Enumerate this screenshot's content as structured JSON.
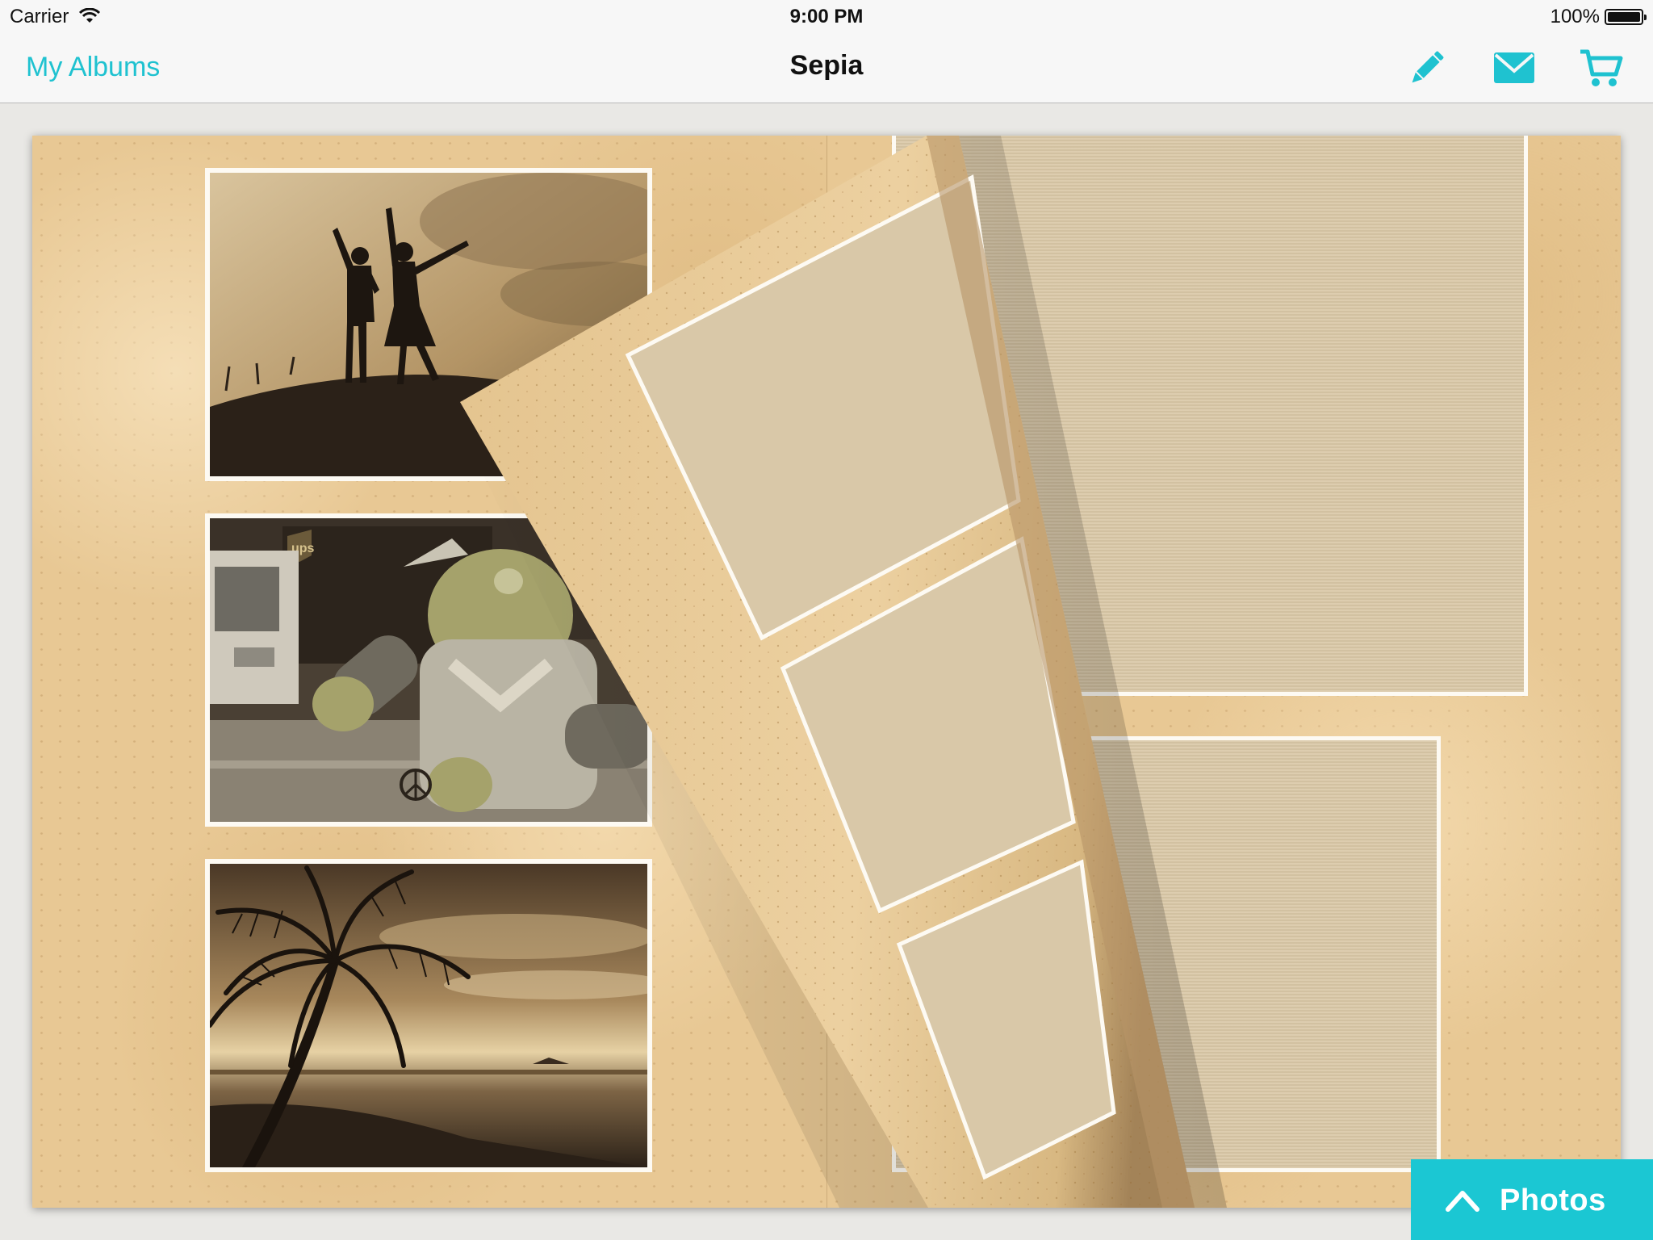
{
  "status_bar": {
    "carrier": "Carrier",
    "time": "9:00 PM",
    "battery": "100%"
  },
  "nav": {
    "back_label": "My Albums",
    "title": "Sepia",
    "actions": [
      "pencil-icon",
      "mail-icon",
      "cart-icon"
    ],
    "accent_color": "#1fc2d0"
  },
  "album": {
    "photos": [
      "silhouette-of-two-girls-on-hill",
      "android-mascot-costume-near-ups-truck",
      "palm-tree-at-beach-sunset"
    ],
    "theme": "sepia"
  },
  "photos_button": {
    "label": "Photos",
    "color": "#1bc7d3"
  }
}
